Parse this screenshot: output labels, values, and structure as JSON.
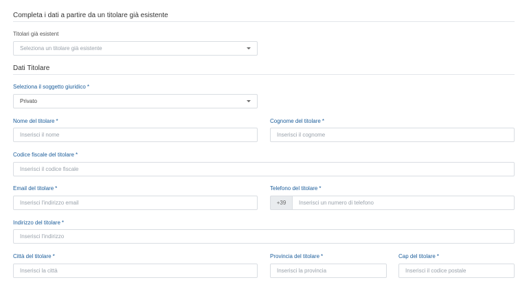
{
  "section_existing": {
    "title": "Completa i dati a partire da un titolare già esistente",
    "existing_label": "Titolari già esistent",
    "existing_placeholder": "Seleziona un titolare già esistente"
  },
  "section_data": {
    "title": "Dati Titolare"
  },
  "fields": {
    "soggetto": {
      "label": "Seleziona il soggetto giuridico",
      "value": "Privato"
    },
    "nome": {
      "label": "Nome del titolare",
      "placeholder": "Inserisci il nome"
    },
    "cognome": {
      "label": "Cognome del titolare",
      "placeholder": "Inserisci il cognome"
    },
    "codice_fiscale": {
      "label": "Codice fiscale del titolare",
      "placeholder": "Inserisci il codice fiscale"
    },
    "email": {
      "label": "Email del titolare",
      "placeholder": "Inserisci l'indirizzo email"
    },
    "telefono": {
      "label": "Telefono del titolare",
      "prefix": "+39",
      "placeholder": "Inserisci un numero di telefono"
    },
    "indirizzo": {
      "label": "Indirizzo del titolare",
      "placeholder": "Inserisci l'indirizzo"
    },
    "citta": {
      "label": "Città del titolare",
      "placeholder": "Inserisci la città"
    },
    "provincia": {
      "label": "Provincia del titolare",
      "placeholder": "Inserisci la provincia"
    },
    "cap": {
      "label": "Cap del titolare",
      "placeholder": "Inserisci il codice postale"
    }
  },
  "required_marker": "*",
  "colors": {
    "required_label": "#1a5c9a",
    "border": "#d9dde2",
    "prefix_bg": "#e9ecef"
  },
  "icons": {
    "select_caret": "chevron-down-icon"
  }
}
